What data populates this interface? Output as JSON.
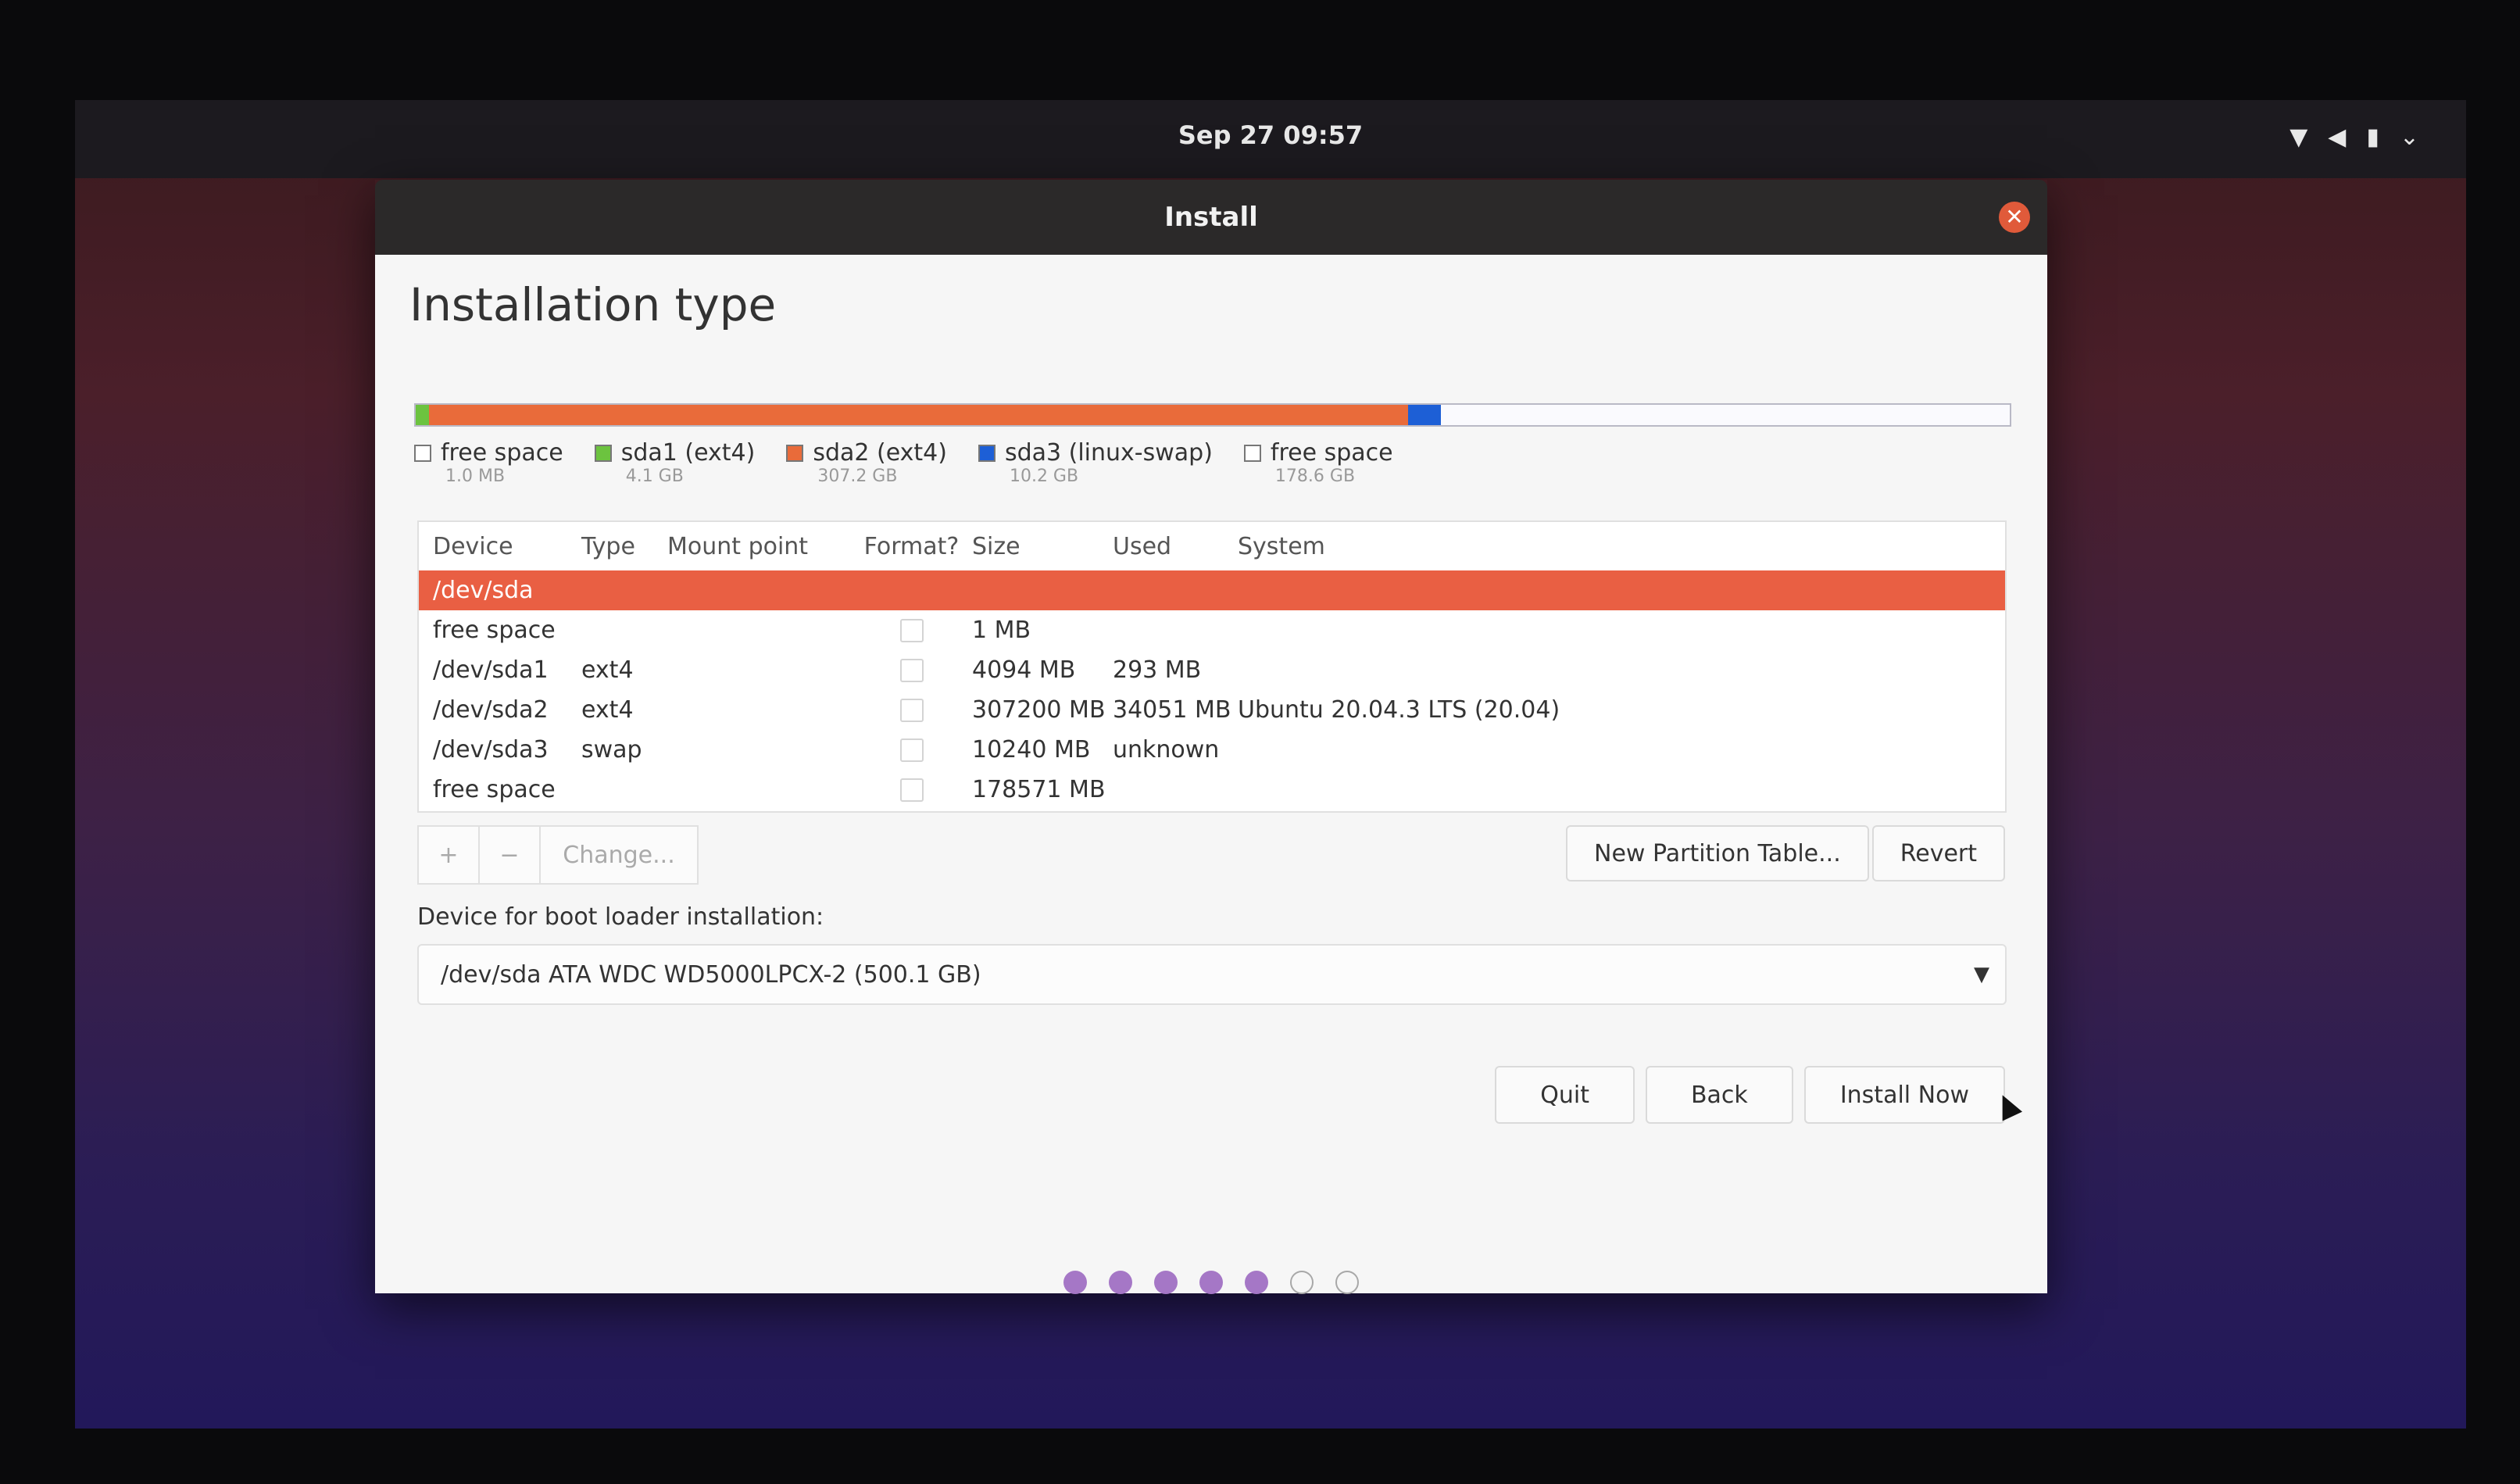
{
  "topbar": {
    "clock": "Sep 27  09:57",
    "tray_icons": [
      "wifi-icon",
      "volume-icon",
      "battery-icon",
      "chevron-down-icon"
    ]
  },
  "window": {
    "title": "Install",
    "close_symbol": "✕"
  },
  "page": {
    "heading": "Installation type"
  },
  "partition_bar": {
    "segments": [
      {
        "name": "free space",
        "fraction": 2e-06,
        "color": "#ffffff"
      },
      {
        "name": "sda1",
        "fraction": 0.0082,
        "color": "#6cc33f"
      },
      {
        "name": "sda2",
        "fraction": 0.6144,
        "color": "#e96b3a"
      },
      {
        "name": "sda3",
        "fraction": 0.0204,
        "color": "#1d5fd6"
      },
      {
        "name": "free space",
        "fraction": 0.357,
        "color": "#fafafe"
      }
    ]
  },
  "legend": [
    {
      "label": "free space",
      "size": "1.0 MB",
      "color": "#ffffff"
    },
    {
      "label": "sda1 (ext4)",
      "size": "4.1 GB",
      "color": "#6cc33f"
    },
    {
      "label": "sda2 (ext4)",
      "size": "307.2 GB",
      "color": "#e96b3a"
    },
    {
      "label": "sda3 (linux-swap)",
      "size": "10.2 GB",
      "color": "#1d5fd6"
    },
    {
      "label": "free space",
      "size": "178.6 GB",
      "color": "#ffffff"
    }
  ],
  "table": {
    "headers": {
      "device": "Device",
      "type": "Type",
      "mount": "Mount point",
      "format": "Format?",
      "size": "Size",
      "used": "Used",
      "system": "System"
    },
    "disk_row": "/dev/sda",
    "rows": [
      {
        "device": "free space",
        "type": "",
        "size": "1 MB",
        "used": "",
        "system": ""
      },
      {
        "device": "/dev/sda1",
        "type": "ext4",
        "size": "4094 MB",
        "used": "293 MB",
        "system": ""
      },
      {
        "device": "/dev/sda2",
        "type": "ext4",
        "size": "307200 MB",
        "used": "34051 MB",
        "system": "Ubuntu 20.04.3 LTS (20.04)"
      },
      {
        "device": "/dev/sda3",
        "type": "swap",
        "size": "10240 MB",
        "used": "unknown",
        "system": ""
      },
      {
        "device": "free space",
        "type": "",
        "size": "178571 MB",
        "used": "",
        "system": ""
      }
    ]
  },
  "toolbar": {
    "add": "+",
    "remove": "−",
    "change": "Change...",
    "new_table": "New Partition Table...",
    "revert": "Revert"
  },
  "boot": {
    "label": "Device for boot loader installation:",
    "value": "/dev/sda   ATA WDC WD5000LPCX-2 (500.1 GB)",
    "arrow": "▼"
  },
  "nav": {
    "quit": "Quit",
    "back": "Back",
    "install": "Install Now"
  },
  "progress": {
    "current_step": 5,
    "total_steps": 7
  },
  "colors": {
    "selected_row": "#e95f43",
    "progress_dot": "#a577c6"
  }
}
